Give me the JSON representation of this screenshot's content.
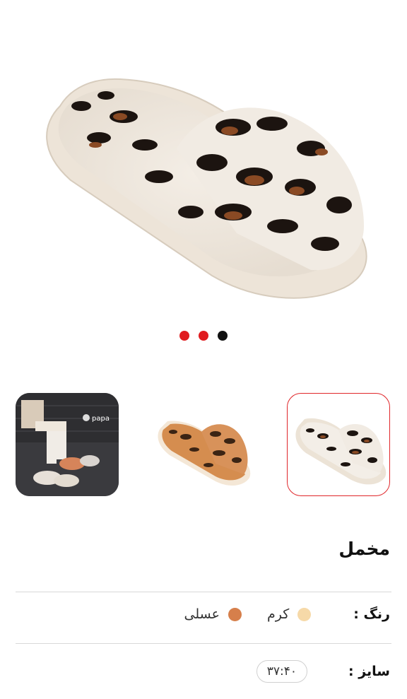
{
  "product": {
    "title": "مخمل"
  },
  "gallery": {
    "dots": [
      "#e01b1f",
      "#e01b1f",
      "#111111"
    ],
    "thumbnails": [
      {
        "name": "thumbnail-cream-slipper",
        "selected": true
      },
      {
        "name": "thumbnail-honey-slipper",
        "selected": false
      },
      {
        "name": "thumbnail-lifestyle-photo",
        "selected": false
      }
    ],
    "brand_logo_text": "papa"
  },
  "color": {
    "label": "رنگ :",
    "options": [
      {
        "label": "کرم",
        "color": "#f6d9a8"
      },
      {
        "label": "عسلی",
        "color": "#d67f4b"
      }
    ]
  },
  "size": {
    "label": "سایز :",
    "value": "۳۷:۴۰"
  }
}
